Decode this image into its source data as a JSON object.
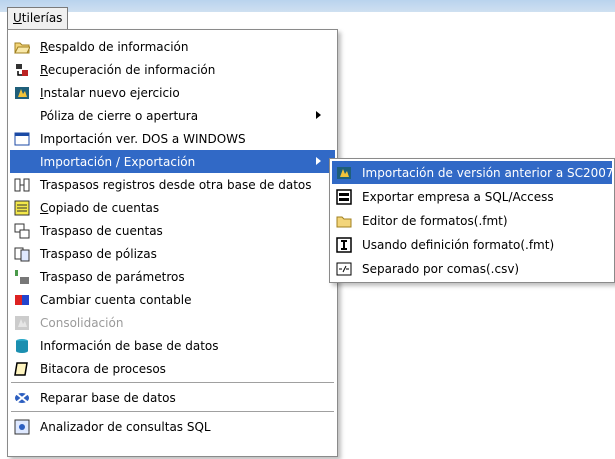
{
  "menubar": {
    "label_prefix": "",
    "label_ul": "U",
    "label_rest": "tilerías"
  },
  "menu": {
    "items": [
      {
        "label": "Respaldo de información",
        "icon": "folder-open-icon"
      },
      {
        "label": "Recuperación de información",
        "icon": "restore-icon"
      },
      {
        "label": "Instalar nuevo ejercicio",
        "icon": "install-icon"
      },
      {
        "label": "Póliza de cierre o apertura",
        "icon": ""
      },
      {
        "label": "Importación ver. DOS a WINDOWS",
        "icon": "window-icon"
      },
      {
        "label": "Importación / Exportación",
        "icon": ""
      },
      {
        "label": "Traspasos registros desde otra base de datos",
        "icon": "transfer-icon"
      },
      {
        "label": "Copiado de cuentas",
        "icon": "copy-accounts-icon"
      },
      {
        "label": "Traspaso de cuentas",
        "icon": "accounts-transfer-icon"
      },
      {
        "label": "Traspaso de pólizas",
        "icon": "policies-icon"
      },
      {
        "label": "Traspaso de parámetros",
        "icon": "parameters-icon"
      },
      {
        "label": "Cambiar cuenta contable",
        "icon": "swap-icon"
      },
      {
        "label": "Consolidación",
        "icon": "consolidation-icon"
      },
      {
        "label": "Información de base de datos",
        "icon": "database-icon"
      },
      {
        "label": "Bitacora de procesos",
        "icon": "log-icon"
      },
      {
        "label": "Reparar base de datos",
        "icon": "repair-icon"
      },
      {
        "label": "Analizador de consultas SQL",
        "icon": "sql-analyzer-icon"
      }
    ]
  },
  "submenu": {
    "items": [
      {
        "label": "Importación de versión anterior a SC2007",
        "icon": "import-icon"
      },
      {
        "label": "Exportar empresa a SQL/Access",
        "icon": "export-icon"
      },
      {
        "label": "Editor de formatos(.fmt)",
        "icon": "folder-icon"
      },
      {
        "label": "Usando definición formato(.fmt)",
        "icon": "format-icon"
      },
      {
        "label": "Separado por comas(.csv)",
        "icon": "csv-icon"
      }
    ]
  },
  "colors": {
    "highlight": "#3169c6",
    "disabled": "#9a9a9a"
  }
}
